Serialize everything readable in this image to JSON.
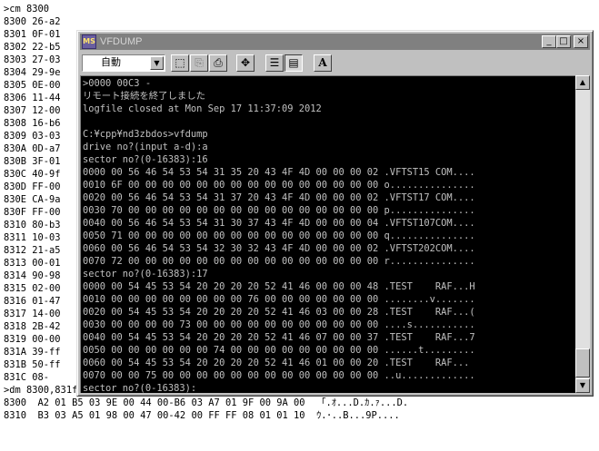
{
  "terminal_background": {
    "lines": [
      ">cm 8300",
      "8300 26-a2",
      "8301 0F-01",
      "8302 22-b5",
      "8303 27-03",
      "8304 29-9e",
      "8305 0E-00",
      "8306 11-44",
      "8307 12-00",
      "8308 16-b6",
      "8309 03-03",
      "830A 0D-a7",
      "830B 3F-01",
      "830C 40-9f",
      "830D FF-00",
      "830E CA-9a",
      "830F FF-00",
      "8310 80-b3",
      "8311 10-03",
      "8312 21-a5",
      "8313 00-01",
      "8314 90-98",
      "8315 02-00",
      "8316 01-47",
      "8317 14-00",
      "8318 2B-42",
      "8319 00-00",
      "831A 39-ff",
      "831B 50-ff",
      "831C 08-",
      ">dm 8300,831f",
      "8300  A2 01 B5 03 9E 00 44 00-B6 03 A7 01 9F 00 9A 00  「.ｵ...D.ｶ.ｧ...D.",
      "8310  B3 03 A5 01 98 00 47 00-42 00 FF FF 08 01 01 10  ｳ.･..B...9P...."
    ]
  },
  "window": {
    "title": "VFDUMP",
    "icon_label": "MS",
    "buttons": {
      "minimize": "_",
      "maximize": "□",
      "close": "×"
    },
    "toolbar": {
      "font_select_value": "自動",
      "font_select_arrow": "▼",
      "tools": [
        {
          "name": "mark-tool",
          "glyph": "⬚"
        },
        {
          "name": "copy-tool",
          "glyph": "⎘"
        },
        {
          "name": "paste-tool",
          "glyph": "⎙"
        },
        {
          "name": "fullscreen-tool",
          "glyph": "✥"
        },
        {
          "name": "properties-tool",
          "glyph": "☰"
        },
        {
          "name": "background-tool",
          "glyph": "▤"
        },
        {
          "name": "font-tool",
          "glyph": "A"
        }
      ]
    },
    "console_lines": [
      ">0000 00C3 -",
      "リモート接続を終了しました",
      "logfile closed at Mon Sep 17 11:37:09 2012",
      "",
      "C:¥cpp¥nd3zbdos>vfdump",
      "drive no?(input a-d):a",
      "sector no?(0-16383):16",
      "0000 00 56 46 54 53 54 31 35 20 43 4F 4D 00 00 00 02 .VFTST15 COM....",
      "0010 6F 00 00 00 00 00 00 00 00 00 00 00 00 00 00 00 o...............",
      "0020 00 56 46 54 53 54 31 37 20 43 4F 4D 00 00 00 02 .VFTST17 COM....",
      "0030 70 00 00 00 00 00 00 00 00 00 00 00 00 00 00 00 p...............",
      "0040 00 56 46 54 53 54 31 30 37 43 4F 4D 00 00 00 04 .VFTST107COM....",
      "0050 71 00 00 00 00 00 00 00 00 00 00 00 00 00 00 00 q...............",
      "0060 00 56 46 54 53 54 32 30 32 43 4F 4D 00 00 00 02 .VFTST202COM....",
      "0070 72 00 00 00 00 00 00 00 00 00 00 00 00 00 00 00 r...............",
      "sector no?(0-16383):17",
      "0000 00 54 45 53 54 20 20 20 20 52 41 46 00 00 00 48 .TEST    RAF...H",
      "0010 00 00 00 00 00 00 00 00 76 00 00 00 00 00 00 00 ........v.......",
      "0020 00 54 45 53 54 20 20 20 20 52 41 46 03 00 00 28 .TEST    RAF...(",
      "0030 00 00 00 00 73 00 00 00 00 00 00 00 00 00 00 00 ....s...........",
      "0040 00 54 45 53 54 20 20 20 20 52 41 46 07 00 00 37 .TEST    RAF...7",
      "0050 00 00 00 00 00 00 74 00 00 00 00 00 00 00 00 00 ......t.........",
      "0060 00 54 45 53 54 20 20 20 20 52 41 46 01 00 00 20 .TEST    RAF... ",
      "0070 00 00 75 00 00 00 00 00 00 00 00 00 00 00 00 00 ..u.............",
      "sector no?(0-16383):"
    ],
    "scrollbar": {
      "up": "▲",
      "down": "▼"
    }
  },
  "colors": {
    "console_bg": "#000000",
    "console_text": "#c0c0c0",
    "titlebar_inactive": "#808080",
    "window_face": "#c0c0c0"
  }
}
